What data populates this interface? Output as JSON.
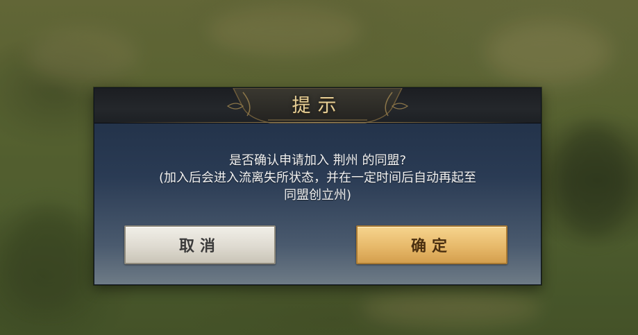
{
  "dialog": {
    "title": "提示",
    "message_lines": [
      "是否确认申请加入 荆州 的同盟?",
      "(加入后会进入流离失所状态，并在一定时间后自动再起至",
      "同盟创立州)"
    ],
    "cancel_label": "取消",
    "confirm_label": "确定"
  },
  "colors": {
    "title_gold": "#e6cf97",
    "confirm_gold": "#e7b96a",
    "cancel_silver": "#dedad0",
    "panel_navy": "#2a3b54"
  },
  "icons": {
    "header_ornament": "ornament-crest"
  }
}
